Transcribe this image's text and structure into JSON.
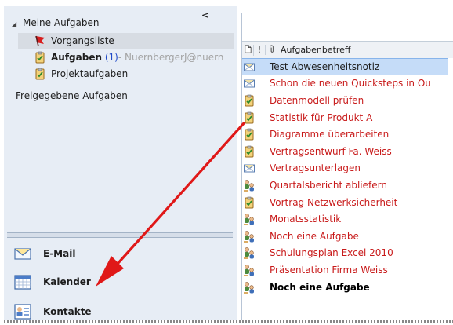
{
  "nav": {
    "collapse_glyph": "<",
    "group_label": "Meine Aufgaben",
    "folders": [
      {
        "label": "Vorgangsliste",
        "icon": "red-flag-icon",
        "selected": true
      },
      {
        "label": "Aufgaben",
        "count": "(1)",
        "account": " - NuernbergerJ@nuern",
        "icon": "task-clipboard-icon"
      },
      {
        "label": "Projektaufgaben",
        "icon": "task-clipboard-icon"
      }
    ],
    "shared_label": "Freigegebene Aufgaben",
    "buttons": [
      {
        "label": "E-Mail",
        "icon": "mail-envelope-icon"
      },
      {
        "label": "Kalender",
        "icon": "calendar-icon"
      },
      {
        "label": "Kontakte",
        "icon": "contacts-card-icon"
      }
    ]
  },
  "list": {
    "header_icons": [
      "document-icon",
      "importance-icon",
      "attachment-icon"
    ],
    "header_importance": "!",
    "column_subject": "Aufgabenbetreff",
    "tasks": [
      {
        "subject": "Test Abwesenheitsnotiz",
        "icon": "task-request-icon",
        "selected": true
      },
      {
        "subject": "Schon die neuen Quicksteps in Ou",
        "icon": "task-request-icon"
      },
      {
        "subject": "Datenmodell prüfen",
        "icon": "task-clipboard-icon"
      },
      {
        "subject": "Statistik für Produkt A",
        "icon": "task-clipboard-icon"
      },
      {
        "subject": "Diagramme überarbeiten",
        "icon": "task-clipboard-icon"
      },
      {
        "subject": "Vertragsentwurf Fa. Weiss",
        "icon": "task-clipboard-icon"
      },
      {
        "subject": "Vertragsunterlagen",
        "icon": "task-request-icon"
      },
      {
        "subject": "Quartalsbericht abliefern",
        "icon": "assigned-task-icon"
      },
      {
        "subject": "Vortrag Netzwerksicherheit",
        "icon": "task-clipboard-icon"
      },
      {
        "subject": "Monatsstatistik",
        "icon": "assigned-task-icon"
      },
      {
        "subject": "Noch eine Aufgabe",
        "icon": "assigned-task-icon"
      },
      {
        "subject": "Schulungsplan Excel 2010",
        "icon": "assigned-task-icon"
      },
      {
        "subject": "Präsentation Firma Weiss",
        "icon": "assigned-task-icon"
      },
      {
        "subject": "Noch eine Aufgabe",
        "icon": "assigned-task-icon",
        "bold": true
      }
    ]
  },
  "colors": {
    "overdue_text": "#c81a1a",
    "nav_background": "#e7edf5",
    "selection": "#c5dcf8",
    "arrow": "#e01818"
  }
}
